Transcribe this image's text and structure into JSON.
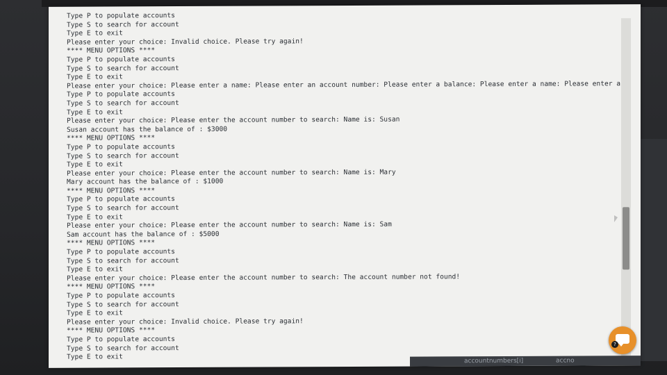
{
  "console": {
    "lines": [
      "Type P to populate accounts",
      "Type S to search for account",
      "Type E to exit",
      "Please enter your choice: Invalid choice. Please try again!",
      "**** MENU OPTIONS ****",
      "Type P to populate accounts",
      "Type S to search for account",
      "Type E to exit",
      "Please enter your choice: Please enter a name: Please enter an account number: Please enter a balance: Please enter a name: Please enter an a",
      "Type P to populate accounts",
      "Type S to search for account",
      "Type E to exit",
      "Please enter your choice: Please enter the account number to search: Name is: Susan",
      "Susan account has the balance of : $3000",
      "**** MENU OPTIONS ****",
      "Type P to populate accounts",
      "Type S to search for account",
      "Type E to exit",
      "Please enter your choice: Please enter the account number to search: Name is: Mary",
      "Mary account has the balance of : $1000",
      "**** MENU OPTIONS ****",
      "Type P to populate accounts",
      "Type S to search for account",
      "Type E to exit",
      "Please enter your choice: Please enter the account number to search: Name is: Sam",
      "Sam account has the balance of : $5000",
      "**** MENU OPTIONS ****",
      "Type P to populate accounts",
      "Type S to search for account",
      "Type E to exit",
      "Please enter your choice: Please enter the account number to search: The account number not found!",
      "**** MENU OPTIONS ****",
      "Type P to populate accounts",
      "Type S to search for account",
      "Type E to exit",
      "Please enter your choice: Invalid choice. Please try again!",
      "**** MENU OPTIONS ****",
      "Type P to populate accounts",
      "Type S to search for account",
      "Type E to exit"
    ]
  },
  "status_bar": {
    "item_1": "accountnumbers[i]",
    "item_2": "accno"
  },
  "chat_button": {
    "icon": "chat-bubble-icon",
    "help_glyph": "?"
  },
  "colors": {
    "console_bg": "#f1f1ef",
    "console_text": "#2b2f35",
    "chat_button": "#e7902a"
  }
}
